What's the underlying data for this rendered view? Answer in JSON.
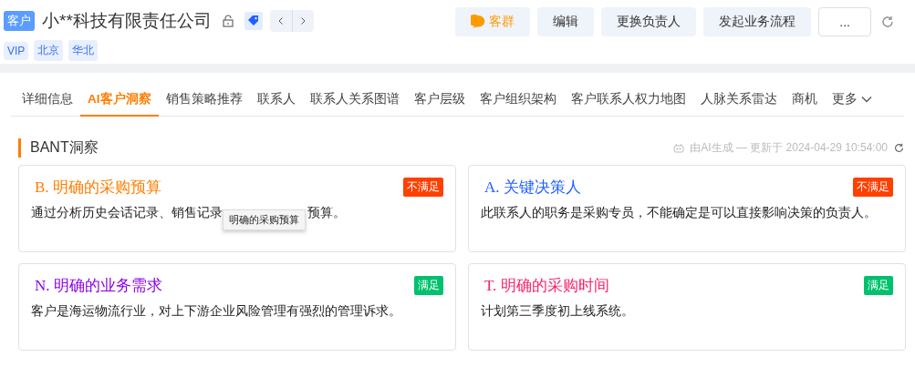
{
  "header": {
    "badge": "客户",
    "title": "小**科技有限责任公司",
    "tags": [
      "VIP",
      "北京",
      "华北"
    ]
  },
  "actions": [
    {
      "kind": "chat",
      "label": "客群"
    },
    {
      "kind": "plain",
      "label": "编辑"
    },
    {
      "kind": "plain",
      "label": "更换负责人"
    },
    {
      "kind": "plain",
      "label": "发起业务流程"
    },
    {
      "kind": "more",
      "label": "..."
    }
  ],
  "tabs": [
    {
      "label": "详细信息",
      "selected": false
    },
    {
      "label": "AI客户洞察",
      "selected": true
    },
    {
      "label": "销售策略推荐",
      "selected": false
    },
    {
      "label": "联系人",
      "selected": false
    },
    {
      "label": "联系人关系图谱",
      "selected": false
    },
    {
      "label": "客户层级",
      "selected": false
    },
    {
      "label": "客户组织架构",
      "selected": false
    },
    {
      "label": "客户联系人权力地图",
      "selected": false
    },
    {
      "label": "人脉关系雷达",
      "selected": false
    },
    {
      "label": "商机",
      "selected": false
    },
    {
      "label": "更多",
      "selected": false
    }
  ],
  "section": {
    "title": "BANT洞察",
    "meta": "由AI生成 — 更新于 2024-04-29 10:54:00"
  },
  "cards": [
    {
      "title": "B. 明确的采购预算",
      "color": "#ff7d00",
      "status": "不满足",
      "satisfied": false,
      "description_parts": [
        "通过分析历史会话记录、销售记录",
        "预算。"
      ],
      "tooltip": "明确的采购预算"
    },
    {
      "title": "A. 关键决策人",
      "color": "#1f5fff",
      "status": "不满足",
      "satisfied": false,
      "description_parts": [
        "此联系人的职务是采购专员，不能确定是可以直接影响决策的负责人。"
      ]
    },
    {
      "title": "N. 明确的业务需求",
      "color": "#8a00e6",
      "status": "满足",
      "satisfied": true,
      "description_parts": [
        "客户是海运物流行业，对上下游企业风险管理有强烈的管理诉求。"
      ]
    },
    {
      "title": "T. 明确的采购时间",
      "color": "#f5226b",
      "status": "满足",
      "satisfied": true,
      "description_parts": [
        "计划第三季度初上线系统。"
      ]
    }
  ]
}
